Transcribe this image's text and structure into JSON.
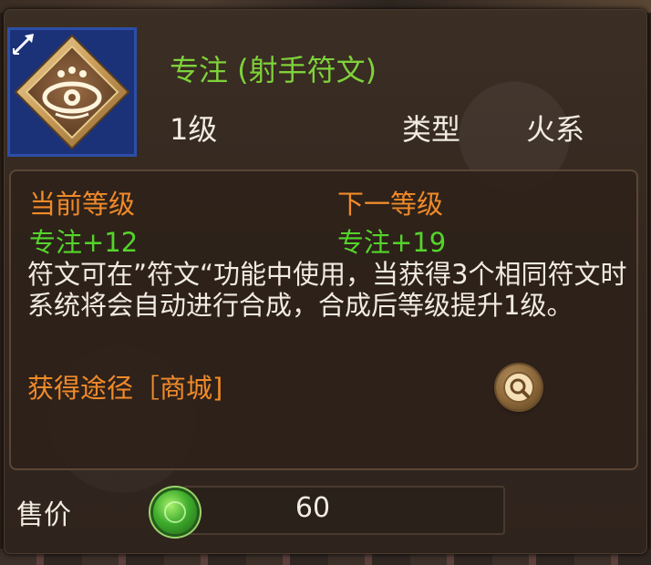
{
  "item": {
    "icon": "eye-rune-icon",
    "badge_icon": "arrow-icon",
    "name": "专注 (射手符文)",
    "level": "1级",
    "type_label": "类型",
    "type_value": "火系"
  },
  "stats": {
    "current_label": "当前等级",
    "next_label": "下一等级",
    "current_value": "专注+12",
    "next_value": "专注+19"
  },
  "description": "符文可在”符文“功能中使用，当获得3个相同符文时系统将会自动进行合成，合成后等级提升1级。",
  "source": {
    "text": "获得途径［商城]",
    "button_icon": "search-icon"
  },
  "price": {
    "label": "售价",
    "currency_icon": "jade-coin-icon",
    "value": "60"
  },
  "colors": {
    "name_green": "#7ed23a",
    "value_green": "#55d42c",
    "label_orange": "#f08a2a",
    "text_light": "#f1ebe2",
    "icon_frame_blue": "#2d4ea8"
  }
}
